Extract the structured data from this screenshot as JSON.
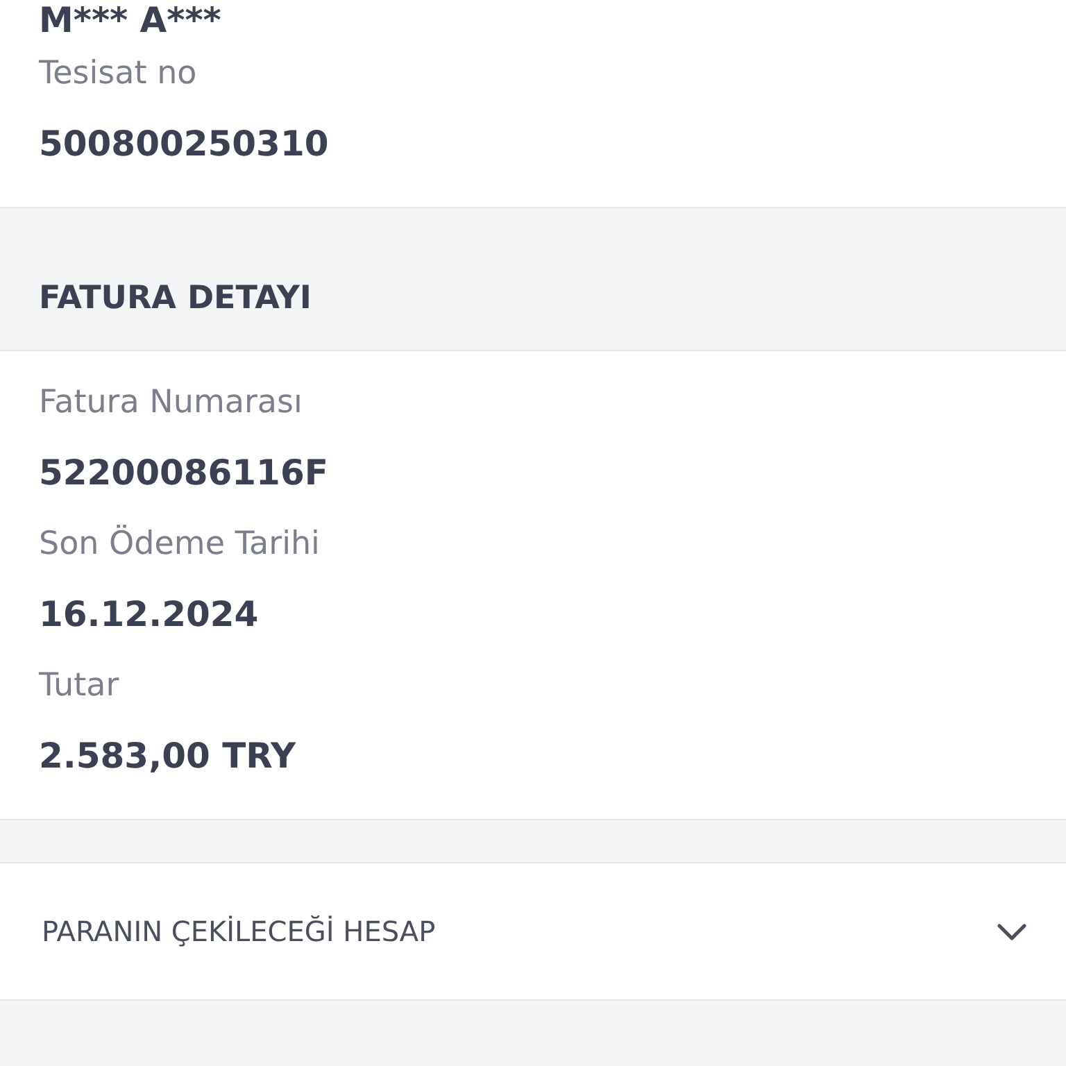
{
  "customer": {
    "name": "M*** A***",
    "fields": [
      {
        "label": "Tesisat no",
        "value": "500800250310"
      }
    ]
  },
  "invoice_detail": {
    "title": "FATURA DETAYI",
    "fields": [
      {
        "label": "Fatura Numarası",
        "value": "52200086116F"
      },
      {
        "label": "Son Ödeme Tarihi",
        "value": "16.12.2024"
      },
      {
        "label": "Tutar",
        "value": "2.583,00 TRY"
      }
    ]
  },
  "account_section": {
    "title": "PARANIN ÇEKİLECEĞİ HESAP",
    "expanded": false
  }
}
